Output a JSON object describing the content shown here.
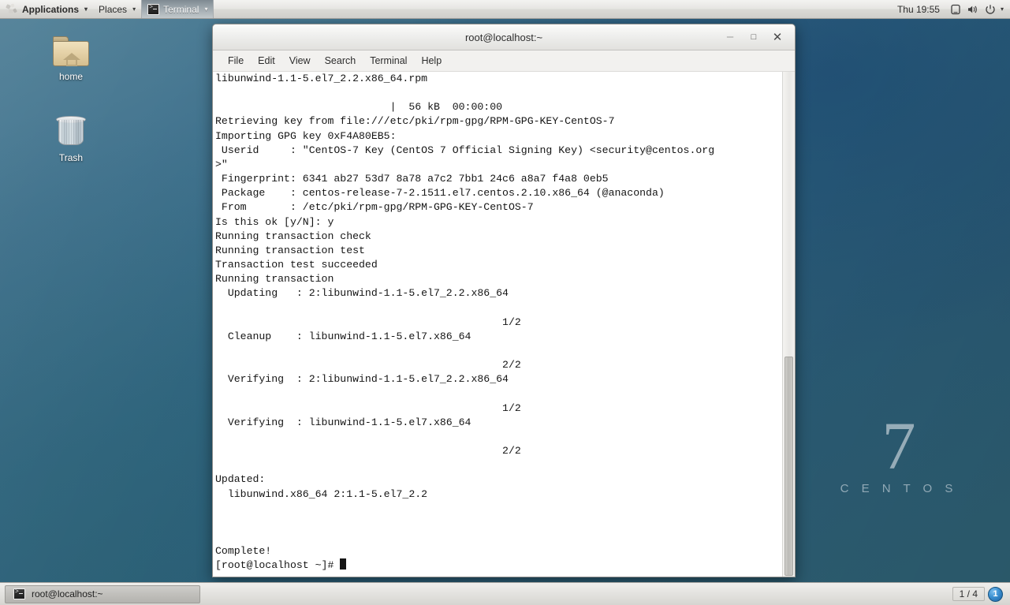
{
  "top_panel": {
    "applications_label": "Applications",
    "places_label": "Places",
    "active_app_label": "Terminal",
    "caret": "▾",
    "clock": "Thu 19:55",
    "tray": {
      "display_icon": "display-icon",
      "volume_icon": "volume-icon",
      "power_icon": "power-icon",
      "caret": "▾"
    }
  },
  "desktop": {
    "icons": [
      {
        "name": "home",
        "label": "home",
        "icon": "home-folder-icon"
      },
      {
        "name": "trash",
        "label": "Trash",
        "icon": "trash-icon"
      }
    ],
    "watermark": {
      "number": "7",
      "word": "C E N T O S"
    }
  },
  "window": {
    "title": "root@localhost:~",
    "buttons": {
      "minimize": "–",
      "maximize": "□",
      "close": "✕"
    },
    "menu": [
      "File",
      "Edit",
      "View",
      "Search",
      "Terminal",
      "Help"
    ],
    "terminal_output": "libunwind-1.1-5.el7_2.2.x86_64.rpm\n\n                            |  56 kB  00:00:00\nRetrieving key from file:///etc/pki/rpm-gpg/RPM-GPG-KEY-CentOS-7\nImporting GPG key 0xF4A80EB5:\n Userid     : \"CentOS-7 Key (CentOS 7 Official Signing Key) <security@centos.org\n>\"\n Fingerprint: 6341 ab27 53d7 8a78 a7c2 7bb1 24c6 a8a7 f4a8 0eb5\n Package    : centos-release-7-2.1511.el7.centos.2.10.x86_64 (@anaconda)\n From       : /etc/pki/rpm-gpg/RPM-GPG-KEY-CentOS-7\nIs this ok [y/N]: y\nRunning transaction check\nRunning transaction test\nTransaction test succeeded\nRunning transaction\n  Updating   : 2:libunwind-1.1-5.el7_2.2.x86_64\n\n                                              1/2\n  Cleanup    : libunwind-1.1-5.el7.x86_64\n\n                                              2/2\n  Verifying  : 2:libunwind-1.1-5.el7_2.2.x86_64\n\n                                              1/2\n  Verifying  : libunwind-1.1-5.el7.x86_64\n\n                                              2/2\n\nUpdated:\n  libunwind.x86_64 2:1.1-5.el7_2.2\n\n\n\nComplete!\n",
    "prompt": "[root@localhost ~]# "
  },
  "taskbar": {
    "task_label": "root@localhost:~",
    "workspace": "1 / 4",
    "notification_count": "1"
  },
  "colors": {
    "desktop_base": "#2e6480",
    "panel_bg": "#e6e5e2",
    "terminal_bg": "#ffffff",
    "terminal_fg": "#151515",
    "accent_blue": "#3a8fd0"
  }
}
